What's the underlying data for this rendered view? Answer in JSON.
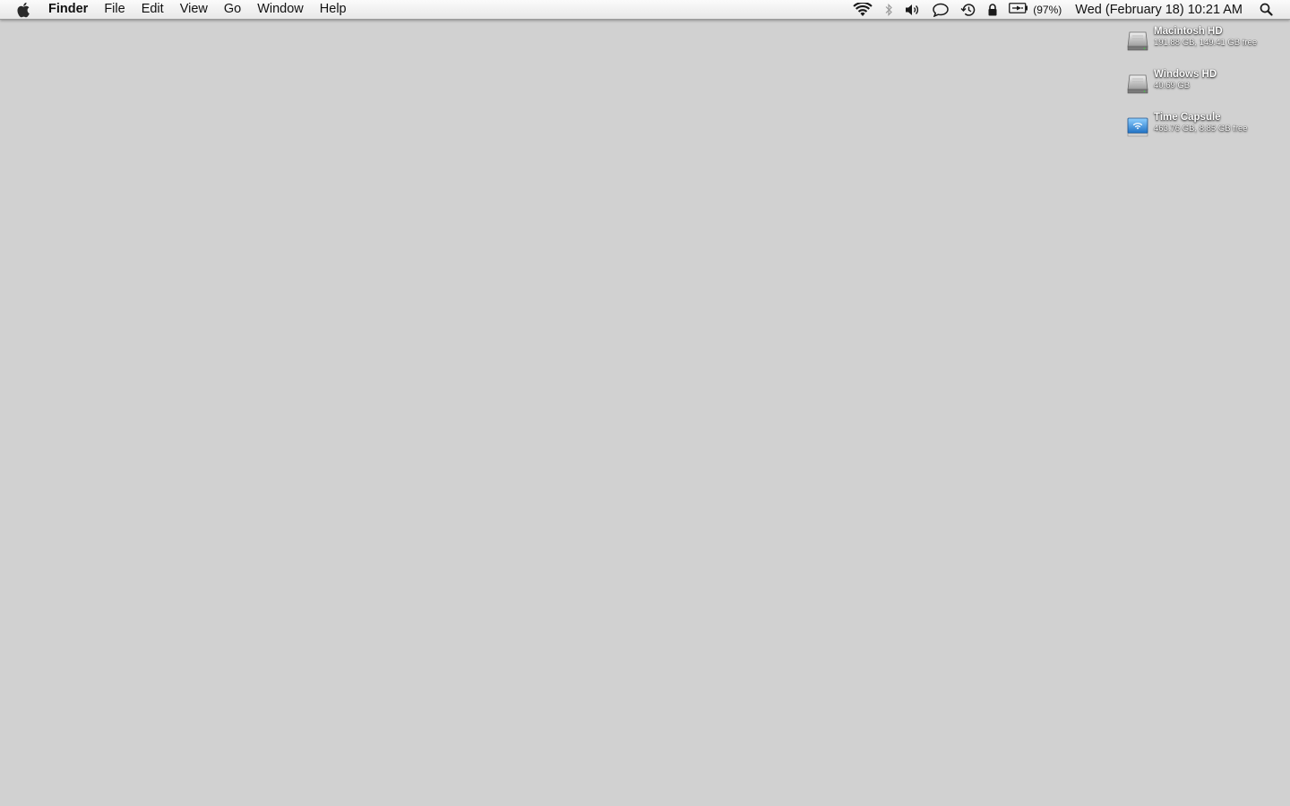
{
  "menubar": {
    "apple_icon": "apple-logo-icon",
    "app_name": "Finder",
    "menus": [
      "File",
      "Edit",
      "View",
      "Go",
      "Window",
      "Help"
    ],
    "status_icons": [
      "wifi-icon",
      "bluetooth-icon",
      "volume-icon",
      "chat-icon",
      "time-machine-icon",
      "lock-icon",
      "battery-icon"
    ],
    "battery_percent": "(97%)",
    "clock": "Wed (February 18) 10:21 AM",
    "spotlight_icon": "search-icon"
  },
  "desktop": {
    "background_color": "#d1d1d1",
    "drives": [
      {
        "name": "Macintosh HD",
        "info": "191.88 GB, 149.41 GB free",
        "icon": "hard-drive-icon"
      },
      {
        "name": "Windows HD",
        "info": "40.69 GB",
        "icon": "hard-drive-icon"
      },
      {
        "name": "Time Capsule",
        "info": "463.76 GB, 8.85 GB free",
        "icon": "network-drive-icon"
      }
    ]
  }
}
